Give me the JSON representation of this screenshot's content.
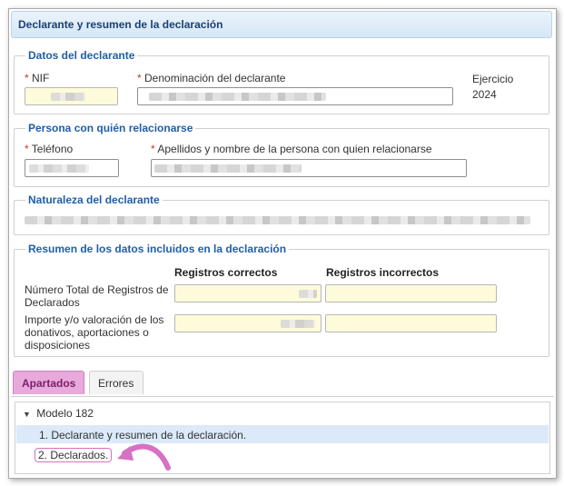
{
  "panel": {
    "title": "Declarante y resumen de la declaración"
  },
  "datos_declarante": {
    "legend": "Datos del declarante",
    "nif_label": "NIF",
    "denominacion_label": "Denominación del declarante",
    "ejercicio_label": "Ejercicio",
    "ejercicio_value": "2024",
    "required_mark": "*"
  },
  "persona": {
    "legend": "Persona con quién relacionarse",
    "telefono_label": "Teléfono",
    "nombre_label": "Apellidos y nombre de la persona con quien relacionarse"
  },
  "naturaleza": {
    "legend": "Naturaleza del declarante"
  },
  "resumen": {
    "legend": "Resumen de los datos incluidos en la declaración",
    "col_correctos": "Registros correctos",
    "col_incorrectos": "Registros incorrectos",
    "rows": [
      {
        "label": "Número Total de Registros de Declarados"
      },
      {
        "label": "Importe y/o valoración de los donativos, aportaciones o disposiciones"
      }
    ]
  },
  "tabs": {
    "apartados": "Apartados",
    "errores": "Errores"
  },
  "tree": {
    "root_icon": "caret-down-icon",
    "root_label": "Modelo 182",
    "items": [
      {
        "label": "1. Declarante y resumen de la declaración."
      },
      {
        "label": "2. Declarados."
      }
    ]
  },
  "colors": {
    "accent": "#1f5fa8",
    "highlight": "#d671c3",
    "selected_row": "#dbe9f8"
  }
}
